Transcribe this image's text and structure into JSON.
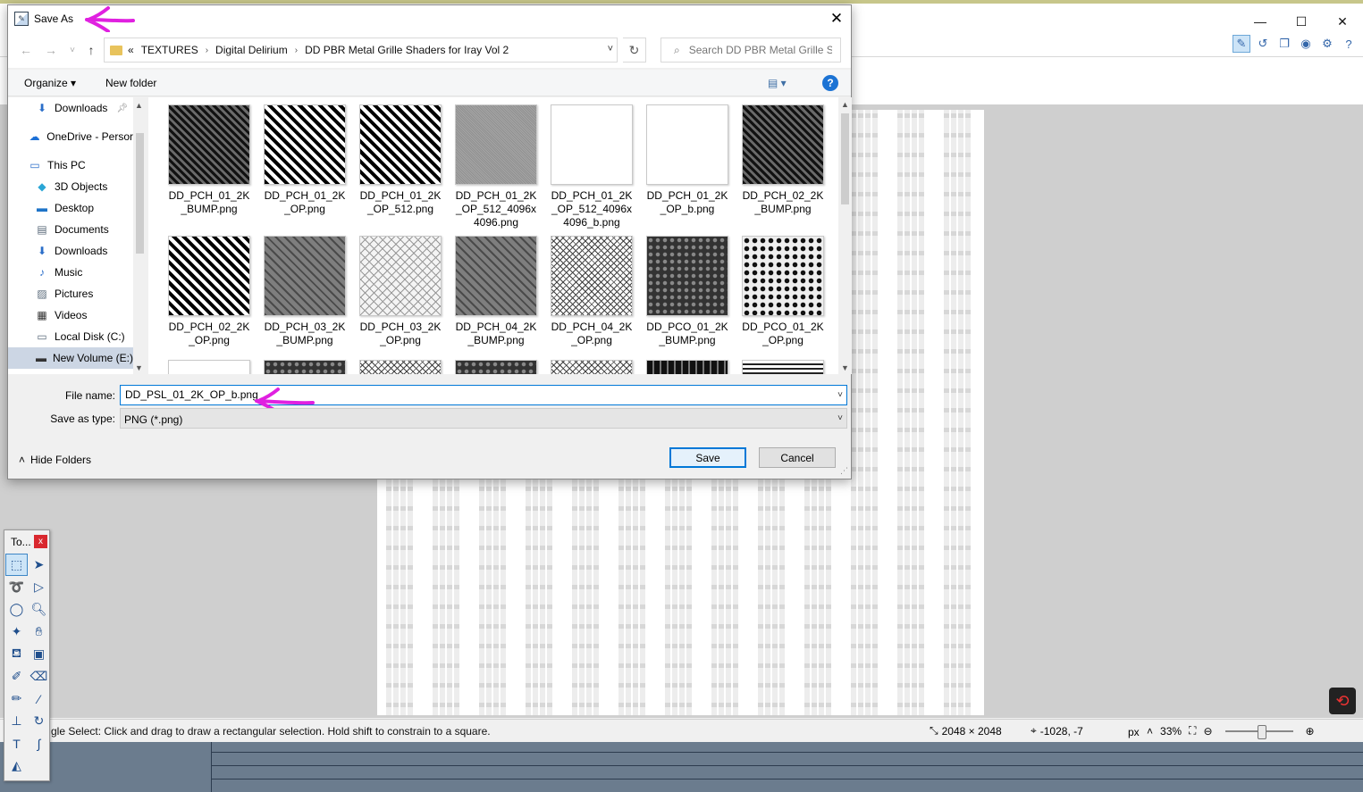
{
  "app": {
    "window_buttons": {
      "minimize": "—",
      "maximize": "☐",
      "close": "✕"
    },
    "status": {
      "text": "gle Select: Click and drag to draw a rectangular selection. Hold shift to constrain to a square.",
      "image_size": "2048 × 2048",
      "cursor": "-1028, -7",
      "unit": "px",
      "zoom": "33%"
    },
    "tools_window": {
      "title": "To...",
      "close": "x"
    }
  },
  "dialog": {
    "title": "Save As",
    "close": "✕",
    "breadcrumb": [
      "«",
      "TEXTURES",
      "Digital Delirium",
      "DD PBR Metal Grille Shaders for Iray Vol 2"
    ],
    "search_placeholder": "Search DD PBR Metal Grille S...",
    "organize": "Organize ▾",
    "new_folder": "New folder",
    "view_icon": "▤ ▾",
    "help": "?",
    "nav_items": [
      {
        "label": "Downloads",
        "icon": "⬇"
      },
      {
        "label": "OneDrive - Persor",
        "icon": "☁"
      },
      {
        "label": "This PC",
        "icon": "▭"
      },
      {
        "label": "3D Objects",
        "icon": "◆"
      },
      {
        "label": "Desktop",
        "icon": "▬"
      },
      {
        "label": "Documents",
        "icon": "▤"
      },
      {
        "label": "Downloads",
        "icon": "⬇"
      },
      {
        "label": "Music",
        "icon": "♪"
      },
      {
        "label": "Pictures",
        "icon": "▨"
      },
      {
        "label": "Videos",
        "icon": "▦"
      },
      {
        "label": "Local Disk (C:)",
        "icon": "▭"
      },
      {
        "label": "New Volume (E:)",
        "icon": "▬"
      }
    ],
    "files": [
      {
        "name": "DD_PCH_01_2K_BUMP.png",
        "texture": "diamond-dark"
      },
      {
        "name": "DD_PCH_01_2K_OP.png",
        "texture": "diamond-bw"
      },
      {
        "name": "DD_PCH_01_2K_OP_512.png",
        "texture": "diamond-bw"
      },
      {
        "name": "DD_PCH_01_2K_OP_512_4096x4096.png",
        "texture": "gray"
      },
      {
        "name": "DD_PCH_01_2K_OP_512_4096x4096_b.png",
        "texture": "white"
      },
      {
        "name": "DD_PCH_01_2K_OP_b.png",
        "texture": "white"
      },
      {
        "name": "DD_PCH_02_2K_BUMP.png",
        "texture": "diamond-dark"
      },
      {
        "name": "DD_PCH_02_2K_OP.png",
        "texture": "diamond-bw"
      },
      {
        "name": "DD_PCH_03_2K_BUMP.png",
        "texture": "diamond-gray"
      },
      {
        "name": "DD_PCH_03_2K_OP.png",
        "texture": "diamond-light"
      },
      {
        "name": "DD_PCH_04_2K_BUMP.png",
        "texture": "diamond-gray"
      },
      {
        "name": "DD_PCH_04_2K_OP.png",
        "texture": "dots-light"
      },
      {
        "name": "DD_PCO_01_2K_BUMP.png",
        "texture": "perf-dark"
      },
      {
        "name": "DD_PCO_01_2K_OP.png",
        "texture": "perf-light"
      },
      {
        "name": "",
        "texture": "white"
      },
      {
        "name": "",
        "texture": "perf-dark"
      },
      {
        "name": "",
        "texture": "dots-light"
      },
      {
        "name": "",
        "texture": "perf-dark"
      },
      {
        "name": "",
        "texture": "dots-light"
      },
      {
        "name": "",
        "texture": "slot-dark"
      },
      {
        "name": "",
        "texture": "slot-bw"
      }
    ],
    "file_name_label": "File name:",
    "file_name_value": "DD_PSL_01_2K_OP_b.png",
    "save_as_type_label": "Save as type:",
    "save_as_type_value": "PNG (*.png)",
    "hide_folders": "Hide Folders",
    "save": "Save",
    "cancel": "Cancel"
  },
  "colors": {
    "accent": "#0078d7",
    "annotation": "#e020e0"
  }
}
